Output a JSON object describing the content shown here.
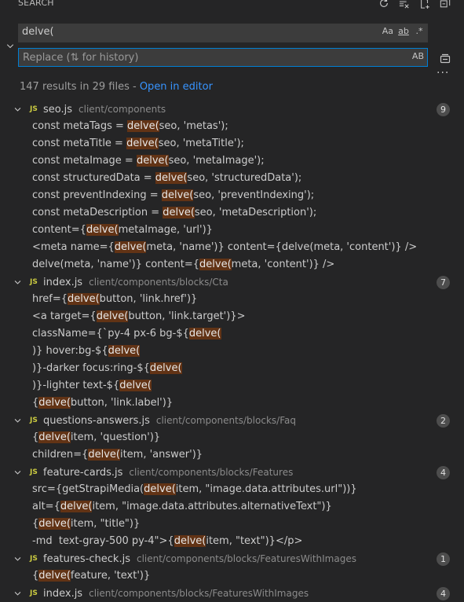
{
  "header": {
    "title": "SEARCH",
    "actions": [
      "refresh-icon",
      "clear-results-icon",
      "new-search-editor-icon",
      "collapse-all-icon"
    ]
  },
  "search": {
    "value": "delve(",
    "options": [
      "Aa",
      "ab",
      ".*"
    ]
  },
  "replace": {
    "placeholder": "Replace (⇅ for history)",
    "option": "AB"
  },
  "summary": {
    "text": "147 results in 29 files - ",
    "link": "Open in editor"
  },
  "colors": {
    "background": "#252526",
    "highlight": "#623315",
    "link": "#3794ff",
    "input_border": "#007fd4"
  },
  "files": [
    {
      "name": "seo.js",
      "path": "client/components",
      "count": "9",
      "matches": [
        [
          "const metaTags = ",
          "delve(",
          "seo, 'metas');"
        ],
        [
          "const metaTitle = ",
          "delve(",
          "seo, 'metaTitle');"
        ],
        [
          "const metaImage = ",
          "delve(",
          "seo, 'metaImage');"
        ],
        [
          "const structuredData = ",
          "delve(",
          "seo, 'structuredData');"
        ],
        [
          "const preventIndexing = ",
          "delve(",
          "seo, 'preventIndexing');"
        ],
        [
          "const metaDescription = ",
          "delve(",
          "seo, 'metaDescription');"
        ],
        [
          "content={",
          "delve(",
          "metaImage, 'url')}"
        ],
        [
          "<meta name={",
          "delve(",
          "meta, 'name')} content={delve(meta, 'content')} />"
        ],
        [
          "delve(meta, 'name')} content={",
          "delve(",
          "meta, 'content')} />"
        ]
      ]
    },
    {
      "name": "index.js",
      "path": "client/components/blocks/Cta",
      "count": "7",
      "matches": [
        [
          "href={",
          "delve(",
          "button, 'link.href')}"
        ],
        [
          "<a target={",
          "delve(",
          "button, 'link.target')}>"
        ],
        [
          "className={`py-4 px-6 bg-${",
          "delve(",
          ""
        ],
        [
          ")} hover:bg-${",
          "delve(",
          ""
        ],
        [
          ")}-darker focus:ring-${",
          "delve(",
          ""
        ],
        [
          ")}-lighter text-${",
          "delve(",
          ""
        ],
        [
          "{",
          "delve(",
          "button, 'link.label')}"
        ]
      ]
    },
    {
      "name": "questions-answers.js",
      "path": "client/components/blocks/Faq",
      "count": "2",
      "matches": [
        [
          "{",
          "delve(",
          "item, 'question')}"
        ],
        [
          "children={",
          "delve(",
          "item, 'answer')}"
        ]
      ]
    },
    {
      "name": "feature-cards.js",
      "path": "client/components/blocks/Features",
      "count": "4",
      "matches": [
        [
          "src={getStrapiMedia(",
          "delve(",
          "item, \"image.data.attributes.url\"))}"
        ],
        [
          "alt={",
          "delve(",
          "item, \"image.data.attributes.alternativeText\")}"
        ],
        [
          "{",
          "delve(",
          "item, \"title\")}"
        ],
        [
          "-md  text-gray-500 py-4\">{",
          "delve(",
          "item, \"text\")}</p>"
        ]
      ]
    },
    {
      "name": "features-check.js",
      "path": "client/components/blocks/FeaturesWithImages",
      "count": "1",
      "matches": [
        [
          "{",
          "delve(",
          "feature, 'text')}"
        ]
      ]
    },
    {
      "name": "index.js",
      "path": "client/components/blocks/FeaturesWithImages",
      "count": "4",
      "matches": []
    }
  ]
}
